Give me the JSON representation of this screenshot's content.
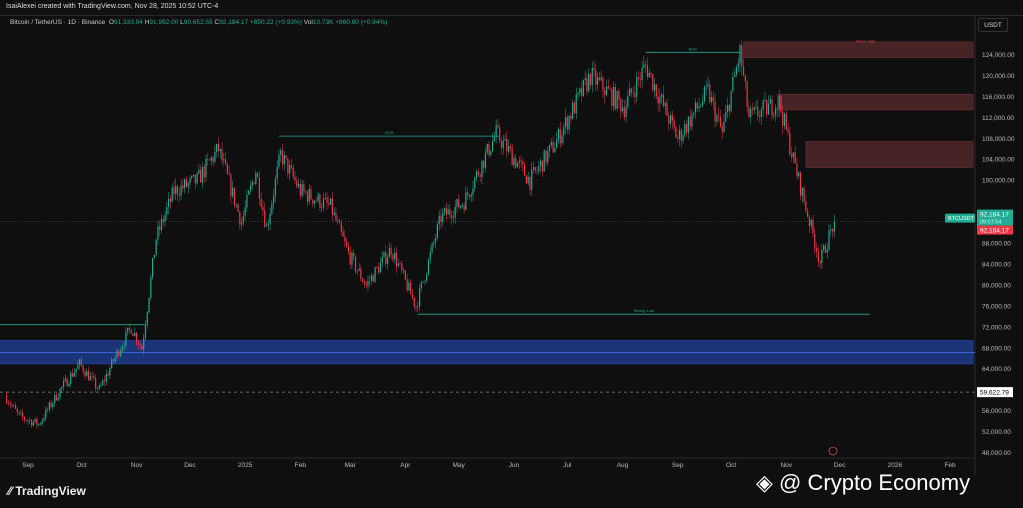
{
  "header": {
    "credit": "IsaiAlexei created with TradingView.com, Nov 28, 2025 10:52 UTC-4"
  },
  "legend": {
    "symbol": "Bitcoin / TetherUS · 1D · Binance",
    "o_label": "O",
    "o": "91,333.94",
    "h_label": "H",
    "h": "91,992.00",
    "l_label": "L",
    "l": "90,652.55",
    "c_label": "C",
    "c": "92,184.17",
    "change": "+850.22 (+0.93%)",
    "vol_label": "Vol",
    "vol": "10.73K",
    "vol_change": "+860.60 (+0.94%)"
  },
  "currency": "USDT",
  "price_tags": {
    "symbol": "BTCUSDT",
    "last": "92,184.17",
    "countdown": "09:07:54",
    "prev": "92,184.17",
    "marker": "59,622.79"
  },
  "footer": {
    "logo": "TradingView",
    "watermark": "@ Crypto Economy"
  },
  "colors": {
    "up": "#22ab94",
    "down": "#f23645",
    "zone_red": "#5a2a2e",
    "zone_blue": "#1e3a8a",
    "line": "#22ab94"
  },
  "chart_data": {
    "type": "candlestick",
    "ylim": [
      46000,
      128000
    ],
    "y_ticks": [
      48000,
      52000,
      56000,
      60000,
      64000,
      68000,
      72000,
      76000,
      80000,
      84000,
      88000,
      92000,
      96000,
      100000,
      104000,
      108000,
      112000,
      116000,
      120000,
      124000
    ],
    "y_tick_labels": [
      "48,000.00",
      "52,000.00",
      "56,000.00",
      "",
      "64,000.00",
      "68,000.00",
      "72,000.00",
      "76,000.00",
      "80,000.00",
      "84,000.00",
      "88,000.00",
      "",
      "",
      "100,000.00",
      "104,000.00",
      "108,000.00",
      "112,000.00",
      "116,000.00",
      "120,000.00",
      "124,000.00"
    ],
    "x_ticks": [
      {
        "label": "Sep",
        "day": 0
      },
      {
        "label": "Oct",
        "day": 30
      },
      {
        "label": "Nov",
        "day": 61
      },
      {
        "label": "Dec",
        "day": 91
      },
      {
        "label": "2025",
        "day": 122
      },
      {
        "label": "Feb",
        "day": 153
      },
      {
        "label": "Mar",
        "day": 181
      },
      {
        "label": "Apr",
        "day": 212
      },
      {
        "label": "May",
        "day": 242
      },
      {
        "label": "Jun",
        "day": 273
      },
      {
        "label": "Jul",
        "day": 303
      },
      {
        "label": "Aug",
        "day": 334
      },
      {
        "label": "Sep",
        "day": 365
      },
      {
        "label": "Oct",
        "day": 395
      },
      {
        "label": "Nov",
        "day": 426
      },
      {
        "label": "Dec",
        "day": 456
      },
      {
        "label": "2026",
        "day": 487
      },
      {
        "label": "Feb",
        "day": 518
      }
    ],
    "path": [
      [
        -13,
        59000
      ],
      [
        -5,
        55000
      ],
      [
        6,
        53500
      ],
      [
        18,
        60000
      ],
      [
        29,
        65000
      ],
      [
        40,
        60000
      ],
      [
        50,
        67000
      ],
      [
        58,
        72000
      ],
      [
        64,
        68000
      ],
      [
        72,
        89000
      ],
      [
        82,
        98000
      ],
      [
        95,
        100000
      ],
      [
        107,
        106000
      ],
      [
        120,
        92000
      ],
      [
        128,
        102000
      ],
      [
        134,
        91000
      ],
      [
        142,
        105000
      ],
      [
        153,
        98000
      ],
      [
        170,
        95000
      ],
      [
        180,
        86000
      ],
      [
        190,
        80000
      ],
      [
        204,
        87000
      ],
      [
        218,
        76000
      ],
      [
        232,
        93000
      ],
      [
        245,
        96000
      ],
      [
        263,
        109000
      ],
      [
        282,
        100000
      ],
      [
        296,
        107000
      ],
      [
        316,
        120000
      ],
      [
        335,
        114000
      ],
      [
        347,
        122000
      ],
      [
        365,
        108000
      ],
      [
        382,
        117000
      ],
      [
        390,
        109000
      ],
      [
        400,
        124500
      ],
      [
        405,
        112000
      ],
      [
        422,
        115000
      ],
      [
        430,
        104000
      ],
      [
        445,
        84500
      ],
      [
        453,
        92184
      ]
    ],
    "zones": [
      {
        "type": "supply",
        "from_day": 402,
        "to_day": 531,
        "low": 123500,
        "high": 126500
      },
      {
        "type": "supply",
        "from_day": 421,
        "to_day": 531,
        "low": 113500,
        "high": 116500
      },
      {
        "type": "supply",
        "from_day": 437,
        "to_day": 531,
        "low": 102500,
        "high": 107500
      },
      {
        "type": "demand",
        "from_day": -16,
        "to_day": 531,
        "low": 65000,
        "high": 69500
      }
    ],
    "levels": [
      {
        "price": 108500,
        "from_day": 141,
        "to_day": 265,
        "label": "BOS"
      },
      {
        "price": 124500,
        "from_day": 347,
        "to_day": 400,
        "label": "BOS"
      },
      {
        "price": 74500,
        "from_day": 219,
        "to_day": 473,
        "label": "Strong Low"
      },
      {
        "price": 72500,
        "from_day": -16,
        "to_day": 66,
        "label": ""
      },
      {
        "price": 126000,
        "from_day": 470,
        "to_day": 471,
        "label": "Weak High"
      }
    ],
    "marker_price": 59622.79,
    "last_price": 92184.17
  }
}
